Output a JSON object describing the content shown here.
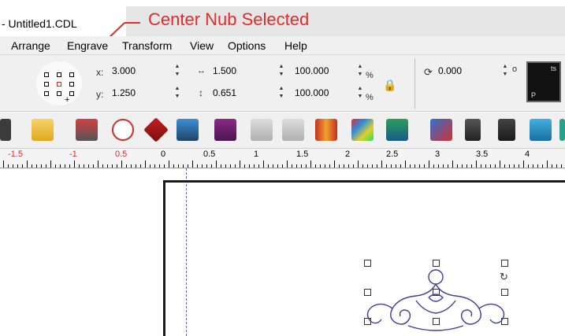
{
  "window": {
    "title": "- Untitled1.CDL"
  },
  "annotation": {
    "text": "Center Nub Selected",
    "color": "#e32b2b"
  },
  "menu": {
    "items": [
      "Arrange",
      "Engrave",
      "Transform",
      "View",
      "Options",
      "Help"
    ]
  },
  "properties": {
    "x_label": "x:",
    "x_value": "3.000",
    "y_label": "y:",
    "y_value": "1.250",
    "width_value": "1.500",
    "height_value": "0.651",
    "scale_x_value": "100.000",
    "scale_y_value": "100.000",
    "percent_symbol": "%",
    "rotation_value": "0.000",
    "degree_symbol": "o",
    "preview_bottom": "P",
    "preview_top": "ts",
    "selected_nub": "center"
  },
  "toolbar": {
    "icons": [
      "open-file-icon",
      "print-icon",
      "plot-icon",
      "undo-icon",
      "flip-icon",
      "zoom-object-icon",
      "book-icon",
      "weld-icon",
      "break-weld-icon",
      "shield-icon",
      "color-palette-icon",
      "group-icon",
      "delete-node-icon",
      "edit-node-icon",
      "pen-tool-icon",
      "text-tool-icon"
    ]
  },
  "ruler": {
    "labels": [
      "-1.5",
      "-1",
      "0.5",
      "0",
      "0.5",
      "1",
      "1.5",
      "2",
      "2.5",
      "3",
      "3.5",
      "4"
    ]
  },
  "colors": {
    "accent_red": "#e32b2b",
    "selection_blue": "#3d3fa0",
    "guide_blue": "#5b67c7"
  }
}
